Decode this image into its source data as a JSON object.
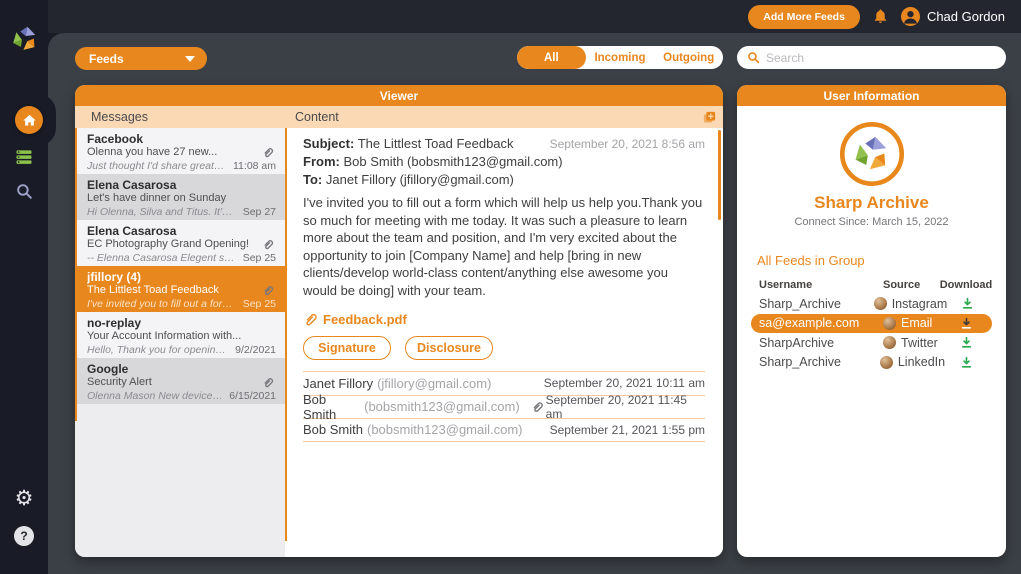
{
  "topbar": {
    "add_more_feeds_label": "Add More Feeds",
    "user_name": "Chad Gordon"
  },
  "filters": {
    "feeds_label": "Feeds",
    "tabs": [
      {
        "label": "All",
        "active": true
      },
      {
        "label": "Incoming",
        "active": false
      },
      {
        "label": "Outgoing",
        "active": false
      }
    ],
    "search_placeholder": "Search"
  },
  "viewer": {
    "title": "Viewer",
    "messages_header": "Messages",
    "content_header": "Content",
    "messages": [
      {
        "sender": "Facebook",
        "subject": "Olenna you have 27 new...",
        "preview": "Just thought I'd share great news ...",
        "date": "11:08 am",
        "has_attachment": true,
        "state": "unread"
      },
      {
        "sender": "Elena Casarosa",
        "subject": "Let's have dinner on Sunday",
        "preview": "Hi Olenna, Silva and Titus. It's was...",
        "date": "Sep 27",
        "has_attachment": false,
        "state": "read"
      },
      {
        "sender": "Elena Casarosa",
        "subject": "EC Photography Grand Opening!",
        "preview": "-- Elenna Casarosa Elegent store is...",
        "date": "Sep 25",
        "has_attachment": true,
        "state": "unread"
      },
      {
        "sender": "jfillory (4)",
        "subject": "The Littlest Toad Feedback",
        "preview": "I've invited you to fill out a form which...",
        "date": "Sep 25",
        "has_attachment": true,
        "state": "selected"
      },
      {
        "sender": "no-replay",
        "subject": "Your Account Information with...",
        "preview": "Hello, Thank you for opening your...",
        "date": "9/2/2021",
        "has_attachment": false,
        "state": "unread"
      },
      {
        "sender": "Google",
        "subject": "Security Alert",
        "preview": "Olenna Mason New device signed...",
        "date": "6/15/2021",
        "has_attachment": true,
        "state": "read"
      }
    ],
    "content": {
      "subject_label": "Subject:",
      "subject": "The Littlest Toad Feedback",
      "date": "September 20, 2021 8:56 am",
      "from_label": "From:",
      "from": "Bob Smith (bobsmith123@gmail.com)",
      "to_label": "To:",
      "to": "Janet Fillory (jfillory@gmail.com)",
      "body": "I've invited you to fill out a form which will help us help you.Thank you so much for meeting with me today. It was such a pleasure to learn more about the team and position, and I'm very excited about the opportunity to join [Company Name] and help [bring in new clients/develop world-class content/anything else awesome you would be doing] with your team.",
      "attachment_name": "Feedback.pdf",
      "signature_label": "Signature",
      "disclosure_label": "Disclosure",
      "thread": [
        {
          "name": "Janet Fillory",
          "email": "(jfillory@gmail.com)",
          "date": "September 20, 2021 10:11 am",
          "has_attachment": false
        },
        {
          "name": "Bob Smith",
          "email": "(bobsmith123@gmail.com)",
          "date": "September 20, 2021 11:45 am",
          "has_attachment": true
        },
        {
          "name": "Bob Smith",
          "email": "(bobsmith123@gmail.com)",
          "date": "September 21, 2021 1:55 pm",
          "has_attachment": false
        }
      ]
    }
  },
  "user_info": {
    "title": "User Information",
    "name": "Sharp Archive",
    "connect_since": "Connect Since: March 15, 2022",
    "group_label": "All Feeds in Group",
    "table": {
      "headers": [
        "Username",
        "Source",
        "Download"
      ],
      "rows": [
        {
          "username": "Sharp_Archive",
          "source": "Instagram",
          "selected": false
        },
        {
          "username": "sa@example.com",
          "source": "Email",
          "selected": true
        },
        {
          "username": "SharpArchive",
          "source": "Twitter",
          "selected": false
        },
        {
          "username": "Sharp_Archive",
          "source": "LinkedIn",
          "selected": false
        }
      ]
    }
  },
  "icons": {
    "sidebar": [
      "sharp-archive-logo",
      "home-icon",
      "feed-list-icon",
      "search-icon",
      "gear-icon",
      "help-icon"
    ],
    "topbar": [
      "bell-icon",
      "user-avatar-icon"
    ],
    "misc": [
      "paperclip-icon",
      "popout-icon",
      "download-icon",
      "caret-down-icon"
    ],
    "help_glyph": "?",
    "gear_glyph": "⚙"
  },
  "colors": {
    "accent": "#E8871E",
    "accent_light": "#FBD9B4",
    "topbar": "#23262F",
    "sidebar": "#191C26",
    "background": "#3B4046",
    "download_green": "#27A84D"
  }
}
